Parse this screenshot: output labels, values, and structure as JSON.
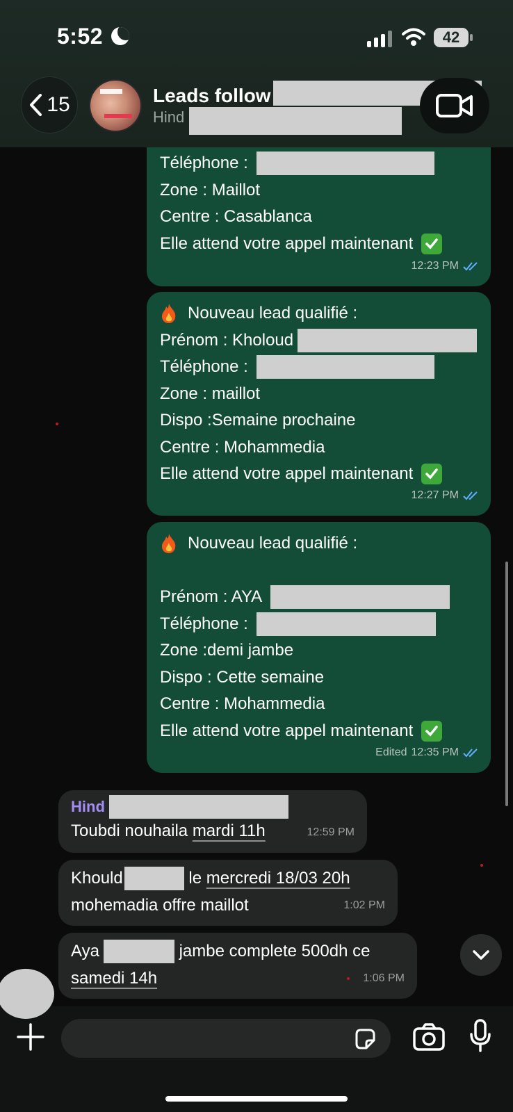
{
  "status_bar": {
    "time": "5:52",
    "battery": "42"
  },
  "header": {
    "back_count": "15",
    "title": "Leads follow",
    "subtitle": "Hind"
  },
  "messages": [
    {
      "lines": [
        "Téléphone :",
        "Zone : Maillot",
        "Centre : Casablanca",
        "Elle attend votre appel maintenant"
      ],
      "time": "12:23 PM"
    },
    {
      "lines": [
        "Nouveau lead qualifié :",
        "Prénom : Kholoud",
        "Téléphone :",
        "Zone : maillot",
        "Dispo :Semaine prochaine",
        "Centre : Mohammedia",
        "Elle attend votre appel maintenant"
      ],
      "time": "12:27 PM"
    },
    {
      "lines": [
        "Nouveau lead qualifié :",
        "Prénom : AYA",
        "Téléphone :",
        "Zone :demi jambe",
        "Dispo : Cette semaine",
        "Centre : Mohammedia",
        "Elle attend votre appel maintenant"
      ],
      "edited": "Edited",
      "time": "12:35 PM"
    },
    {
      "sender": "Hind",
      "text_a": "Toubdi nouhaila",
      "text_b": "mardi 11h",
      "time": "12:59 PM"
    },
    {
      "text_a": "Khould",
      "text_b": "le",
      "text_c": "mercredi 18/03 20h",
      "text_d": "mohemadia offre maillot",
      "time": "1:02 PM"
    },
    {
      "text_a": "Aya",
      "text_b": "jambe complete 500dh ce",
      "text_c": "samedi 14h",
      "time": "1:06 PM"
    }
  ],
  "icons": {
    "back": "chevron-left-icon",
    "video": "video-camera-icon",
    "fire": "fire-emoji-icon",
    "check": "check-mark-emoji-icon",
    "read": "double-check-icon",
    "scroll": "chevron-down-icon",
    "plus": "plus-icon",
    "sticker": "sticker-icon",
    "camera": "camera-icon",
    "mic": "microphone-icon"
  },
  "colors": {
    "outgoing_bubble": "#144d37",
    "incoming_bubble": "#242626",
    "sender_name": "#a68cf5",
    "read_ticks": "#5fb0ff"
  }
}
